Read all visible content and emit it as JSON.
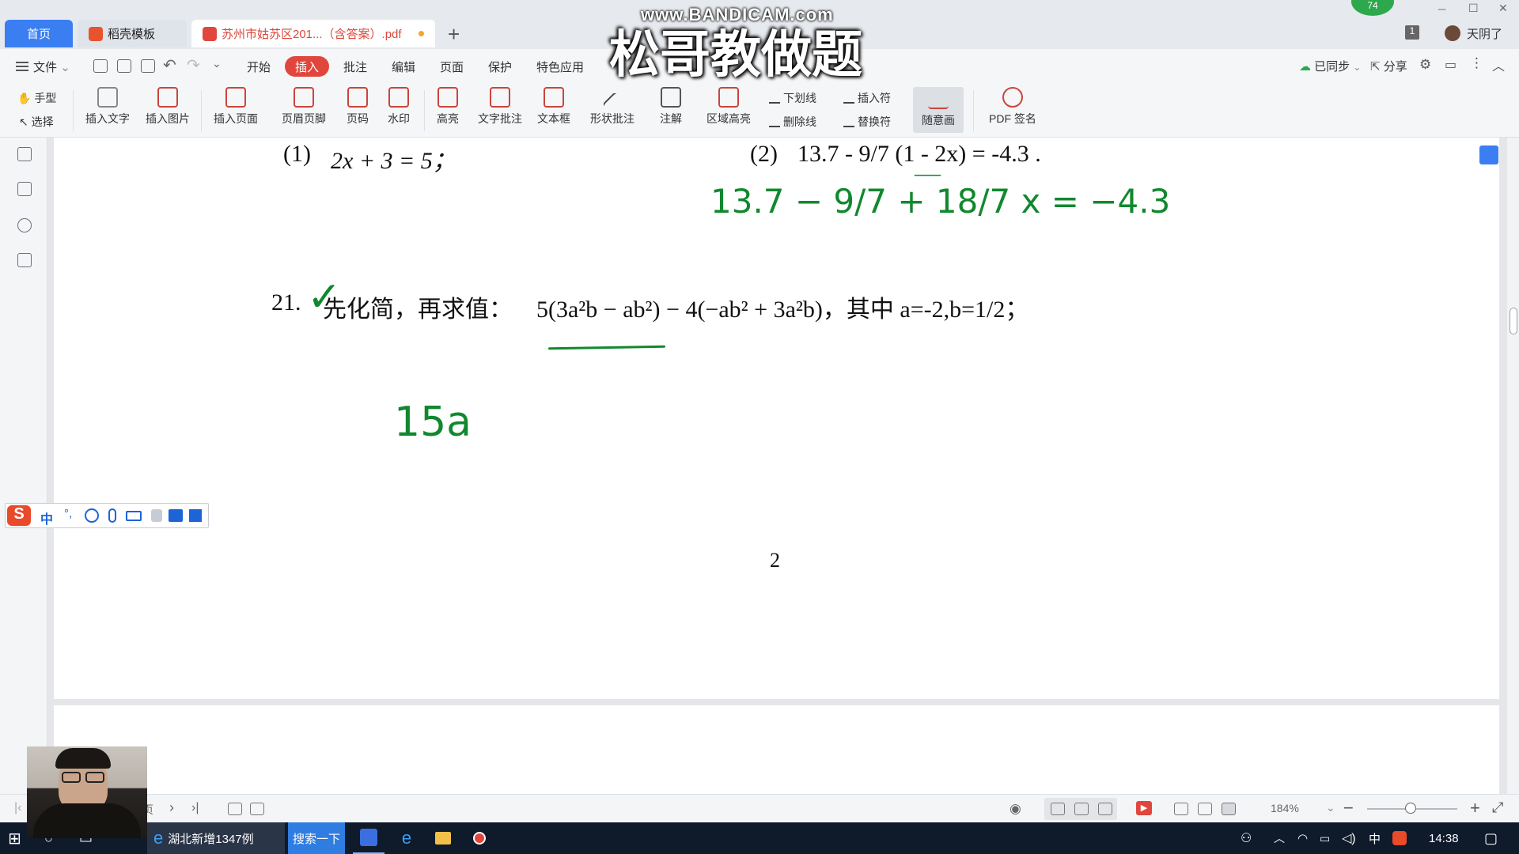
{
  "tabs": {
    "home": "首页",
    "template": "稻壳模板",
    "pdf": "苏州市姑苏区201...（含答案）.pdf",
    "add": "+"
  },
  "window_controls": {
    "badge": "74",
    "minimize": "─",
    "maximize": "☐",
    "close": "✕",
    "notify_count": "1",
    "user": "天阴了"
  },
  "menu": {
    "file": "文件",
    "items": [
      "开始",
      "插入",
      "批注",
      "编辑",
      "页面",
      "保护",
      "特色应用"
    ],
    "active": "插入",
    "sync": "已同步",
    "share": "分享"
  },
  "ribbon": {
    "hand": "手型",
    "select": "选择",
    "insert_text": "插入文字",
    "insert_image": "插入图片",
    "insert_page": "插入页面",
    "header_footer": "页眉页脚",
    "page_number": "页码",
    "watermark": "水印",
    "highlight": "高亮",
    "text_annotation": "文字批注",
    "textbox": "文本框",
    "shape_annotation": "形状批注",
    "note": "注解",
    "area_highlight": "区域高亮",
    "underline": "下划线",
    "strikethrough": "删除线",
    "insert_mark": "插入符",
    "replace_mark": "替换符",
    "freehand": "随意画",
    "pdf_sign": "PDF 签名"
  },
  "document": {
    "eq1_label": "(1)",
    "eq1": "2x + 3 = 5；",
    "eq2_label": "(2)",
    "eq2": "13.7 - 9/7 (1 - 2x) = -4.3 .",
    "problem_no": "21.",
    "problem_text": "先化简，再求值：",
    "problem_expr": "5(3a²b − ab²) − 4(−ab² + 3a²b)，其中 a=-2,b=1/2；",
    "page_number": "2",
    "ink_line1": "13.7 − 9/7 + 18/7 x = −4.3",
    "ink_line2": "15a"
  },
  "status": {
    "zoom": "184%",
    "page_nav": "页"
  },
  "taskbar": {
    "app1": "湖北新增1347例",
    "search": "搜索一下",
    "ime": "中",
    "time": "14:38"
  },
  "watermark": {
    "top": "www.BANDICAM.com",
    "main": "松哥教做题"
  },
  "ime_bar": {
    "mode": "中",
    "punct": "°,"
  }
}
